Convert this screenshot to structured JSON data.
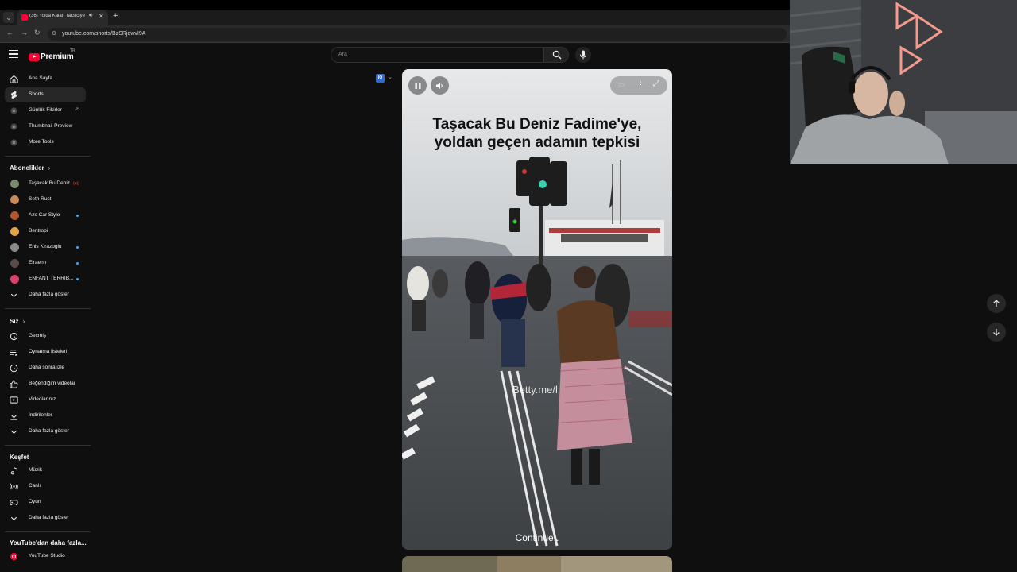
{
  "browser": {
    "tab_title": "(36) Yolda Kalan Taksiciye S...",
    "url": "youtube.com/shorts/BzSRjdwvI9A"
  },
  "header": {
    "logo_text": "Premium",
    "region": "TR",
    "search_placeholder": "Ara"
  },
  "sidebar": {
    "main": [
      {
        "label": "Ana Sayfa",
        "icon": "home-icon"
      },
      {
        "label": "Shorts",
        "icon": "shorts-icon",
        "active": true
      },
      {
        "label": "Günlük Fikirler",
        "icon": "app-icon",
        "external": true
      },
      {
        "label": "Thumbnail Preview",
        "icon": "app-icon"
      },
      {
        "label": "More Tools",
        "icon": "app-icon"
      }
    ],
    "subscriptions_title": "Abonelikler",
    "subscriptions": [
      {
        "label": "Taşacak Bu Deniz",
        "color": "#7a8c6e",
        "badge": "live"
      },
      {
        "label": "Seth Rust",
        "color": "#c98a5a"
      },
      {
        "label": "Azc Car Style",
        "color": "#b3562a",
        "dot": true
      },
      {
        "label": "Bentropi",
        "color": "#e0a34a"
      },
      {
        "label": "Enis Kirazoglu",
        "color": "#8a8a8a",
        "dot": true
      },
      {
        "label": "Elraenn",
        "color": "#5a4a4a",
        "dot": true
      },
      {
        "label": "ENFANT TERRIB...",
        "color": "#e0406a",
        "dot": true
      }
    ],
    "subs_more": "Daha fazla göster",
    "you_title": "Siz",
    "you": [
      {
        "label": "Geçmiş",
        "icon": "history-icon"
      },
      {
        "label": "Oynatma listeleri",
        "icon": "playlist-icon"
      },
      {
        "label": "Daha sonra izle",
        "icon": "clock-icon"
      },
      {
        "label": "Beğendiğim videolar",
        "icon": "like-icon"
      },
      {
        "label": "Videolarınız",
        "icon": "video-icon"
      },
      {
        "label": "İndirilenler",
        "icon": "download-icon"
      }
    ],
    "you_more": "Daha fazla göster",
    "explore_title": "Keşfet",
    "explore": [
      {
        "label": "Müzik",
        "icon": "music-icon"
      },
      {
        "label": "Canlı",
        "icon": "live-icon"
      },
      {
        "label": "Oyun",
        "icon": "gaming-icon"
      }
    ],
    "explore_more": "Daha fazla göster",
    "more_title": "YouTube'dan daha fazla...",
    "more": [
      {
        "label": "YouTube Studio",
        "icon": "studio-icon"
      }
    ]
  },
  "video": {
    "caption_line1": "Taşacak Bu Deniz Fadime'ye,",
    "caption_line2": "yoldan geçen adamın tepkisi",
    "watermark": "Betty.me/l",
    "subtitle": "Continue..",
    "extension_badge": "IQ"
  },
  "colors": {
    "accent": "#ff0033",
    "background": "#0f0f0f",
    "surface": "#272727"
  }
}
